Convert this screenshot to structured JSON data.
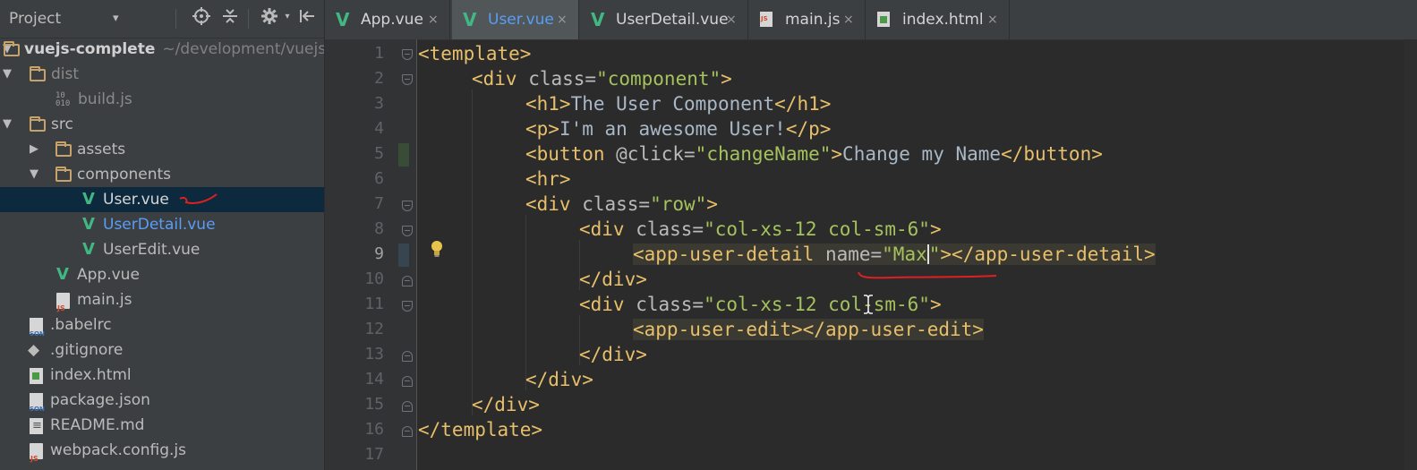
{
  "project": {
    "title": "Project",
    "dropdown": "▾",
    "root_name": "vuejs-complete",
    "root_path": "~/development/vuejs"
  },
  "tree": [
    {
      "id": "root",
      "label": "vuejs-complete"
    },
    {
      "id": "dist",
      "label": "dist"
    },
    {
      "id": "build_js",
      "label": "build.js"
    },
    {
      "id": "src",
      "label": "src"
    },
    {
      "id": "assets",
      "label": "assets"
    },
    {
      "id": "components",
      "label": "components"
    },
    {
      "id": "user_vue",
      "label": "User.vue"
    },
    {
      "id": "userdetail_vue",
      "label": "UserDetail.vue"
    },
    {
      "id": "useredit_vue",
      "label": "UserEdit.vue"
    },
    {
      "id": "app_vue",
      "label": "App.vue"
    },
    {
      "id": "main_js",
      "label": "main.js"
    },
    {
      "id": "babelrc",
      "label": ".babelrc"
    },
    {
      "id": "gitignore",
      "label": ".gitignore"
    },
    {
      "id": "index_html",
      "label": "index.html"
    },
    {
      "id": "package_json",
      "label": "package.json"
    },
    {
      "id": "readme",
      "label": "README.md"
    },
    {
      "id": "webpack",
      "label": "webpack.config.js"
    }
  ],
  "tabs": [
    {
      "label": "App.vue",
      "active": false
    },
    {
      "label": "User.vue",
      "active": true
    },
    {
      "label": "UserDetail.vue",
      "active": false
    },
    {
      "label": "main.js",
      "active": false
    },
    {
      "label": "index.html",
      "active": false
    }
  ],
  "close_glyph": "×",
  "line_numbers": [
    "1",
    "2",
    "3",
    "4",
    "5",
    "6",
    "7",
    "8",
    "9",
    "10",
    "11",
    "12",
    "13",
    "14",
    "15",
    "16",
    "17"
  ],
  "code": {
    "l1_tag": "<template>",
    "l2_open": "<div ",
    "l2_attr": "class=",
    "l2_val": "\"component\"",
    "l2_close": ">",
    "l3_open": "<h1>",
    "l3_text": "The User Component",
    "l3_close": "</h1>",
    "l4_open": "<p>",
    "l4_text": "I'm an awesome User!",
    "l4_close": "</p>",
    "l5_open": "<button ",
    "l5_attr": "@click=",
    "l5_val": "\"changeName\"",
    "l5_gt": ">",
    "l5_text": "Change my Name",
    "l5_close": "</button>",
    "l6_tag": "<hr>",
    "l7_open": "<div ",
    "l7_attr": "class=",
    "l7_val": "\"row\"",
    "l7_close": ">",
    "l8_open": "<div ",
    "l8_attr": "class=",
    "l8_val": "\"col-xs-12 col-sm-6\"",
    "l8_close": ">",
    "l9_open": "<app-user-detail ",
    "l9_attr": "name=",
    "l9_val_a": "\"Max",
    "l9_val_b": "\"",
    "l9_gt": ">",
    "l9_close": "</app-user-detail>",
    "l10_tag": "</div>",
    "l11_open": "<div ",
    "l11_attr": "class=",
    "l11_val": "\"col-xs-12 col-sm-6\"",
    "l11_close": ">",
    "l12_open": "<app-user-edit>",
    "l12_close": "</app-user-edit>",
    "l13_tag": "</div>",
    "l14_tag": "</div>",
    "l15_tag": "</div>",
    "l16_tag": "</template>"
  },
  "colors": {
    "tag": "#e8bf6a",
    "string": "#a5c25c",
    "attribute": "#bababa",
    "vue_green": "#41b883",
    "annotation_red": "#e02020"
  },
  "icons": {
    "target": "crosshair-icon",
    "collapse": "collapse-icon",
    "settings": "gear-icon",
    "hide": "hide-panel-icon",
    "bulb": "lightbulb-icon"
  }
}
